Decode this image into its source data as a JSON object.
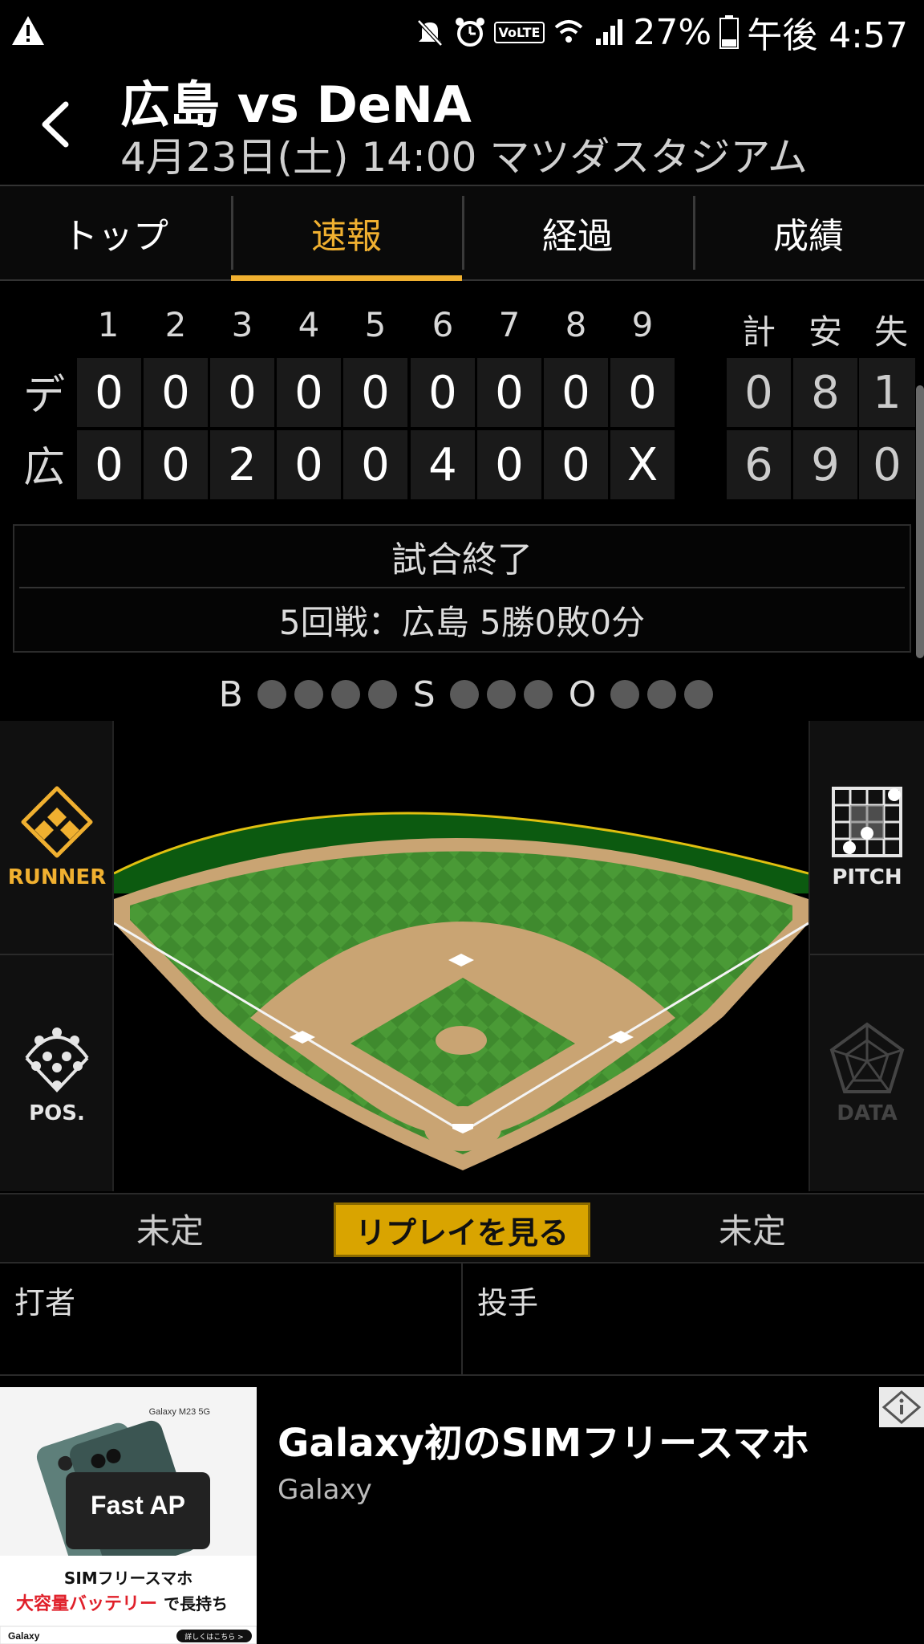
{
  "status_bar": {
    "battery": "27%",
    "time": "午後 4:57",
    "network_label": "VoLTE"
  },
  "header": {
    "title": "広島 vs DeNA",
    "subtitle": "4月23日(土) 14:00 マツダスタジアム"
  },
  "tabs": [
    {
      "label": "トップ",
      "active": false
    },
    {
      "label": "速報",
      "active": true
    },
    {
      "label": "経過",
      "active": false
    },
    {
      "label": "成績",
      "active": false
    }
  ],
  "scoreboard": {
    "innings": [
      "1",
      "2",
      "3",
      "4",
      "5",
      "6",
      "7",
      "8",
      "9"
    ],
    "totals_headers": [
      "計",
      "安",
      "失"
    ],
    "teams": [
      {
        "abbr": "デ",
        "innings": [
          "0",
          "0",
          "0",
          "0",
          "0",
          "0",
          "0",
          "0",
          "0"
        ],
        "totals": [
          "0",
          "8",
          "1"
        ]
      },
      {
        "abbr": "広",
        "innings": [
          "0",
          "0",
          "2",
          "0",
          "0",
          "4",
          "0",
          "0",
          "X"
        ],
        "totals": [
          "6",
          "9",
          "0"
        ]
      }
    ]
  },
  "game_status": {
    "state": "試合終了",
    "series": "5回戦：広島 5勝0敗0分"
  },
  "count": {
    "b_label": "B",
    "s_label": "S",
    "o_label": "O",
    "balls": 4,
    "strikes": 3,
    "outs": 3
  },
  "side_buttons": {
    "runner": "RUNNER",
    "pitch": "PITCH",
    "pos": "POS.",
    "data": "DATA"
  },
  "bottom_bar": {
    "left": "未定",
    "replay": "リプレイを見る",
    "right": "未定"
  },
  "players": {
    "batter": "打者",
    "pitcher": "投手"
  },
  "ad": {
    "title": "Galaxy初のSIMフリースマホ",
    "brand": "Galaxy",
    "image_model": "Galaxy M23 5G",
    "image_badge": "Fast AP",
    "image_line1": "SIMフリースマホ",
    "image_line2_red": "大容量バッテリー",
    "image_line2_rest": "で長持ち",
    "image_footer_left": "Galaxy",
    "image_footer_right": "詳しくはこちら >"
  },
  "colors": {
    "accent": "#f0b030",
    "replay_button": "#d9a400"
  }
}
